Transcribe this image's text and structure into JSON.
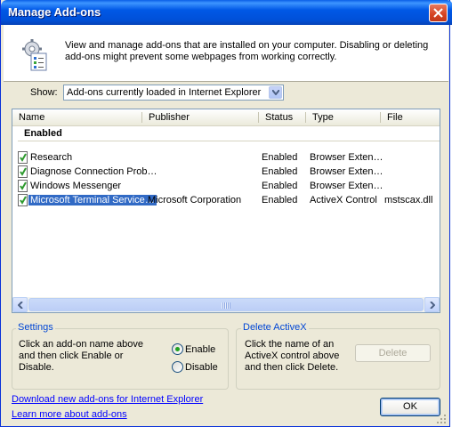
{
  "window": {
    "title": "Manage Add-ons"
  },
  "header": {
    "description": "View and manage add-ons that are installed on your computer. Disabling or deleting add-ons might prevent some webpages from working correctly."
  },
  "show": {
    "label": "Show:",
    "selected": "Add-ons currently loaded in Internet Explorer"
  },
  "list": {
    "columns": [
      "Name",
      "Publisher",
      "Status",
      "Type",
      "File"
    ],
    "group": "Enabled",
    "rows": [
      {
        "name": "Research",
        "publisher": "",
        "status": "Enabled",
        "type": "Browser Exten…",
        "file": "",
        "selected": false
      },
      {
        "name": "Diagnose Connection Prob…",
        "publisher": "",
        "status": "Enabled",
        "type": "Browser Exten…",
        "file": "",
        "selected": false
      },
      {
        "name": "Windows Messenger",
        "publisher": "",
        "status": "Enabled",
        "type": "Browser Exten…",
        "file": "",
        "selected": false
      },
      {
        "name": "Microsoft Terminal Service…",
        "publisher": "Microsoft Corporation",
        "status": "Enabled",
        "type": "ActiveX Control",
        "file": "mstscax.dll",
        "selected": true
      }
    ]
  },
  "settings": {
    "title": "Settings",
    "text": "Click an add-on name above and then click Enable or Disable.",
    "enable_label": "Enable",
    "disable_label": "Disable",
    "enable_checked": true
  },
  "delete_activex": {
    "title": "Delete ActiveX",
    "text": "Click the name of an ActiveX control above and then click Delete.",
    "delete_label": "Delete"
  },
  "links": {
    "download": "Download new add-ons for Internet Explorer",
    "learn": "Learn more about add-ons"
  },
  "ok_label": "OK",
  "colors": {
    "selection": "#316ac5",
    "titlebar": "#0058e6",
    "link": "#0000ff",
    "radio_dot": "#21a121"
  },
  "icons": [
    "close-icon",
    "addons-gear-icon",
    "dropdown-arrow-icon",
    "addon-icon",
    "scroll-left-icon",
    "scroll-right-icon",
    "resize-grip-icon"
  ]
}
